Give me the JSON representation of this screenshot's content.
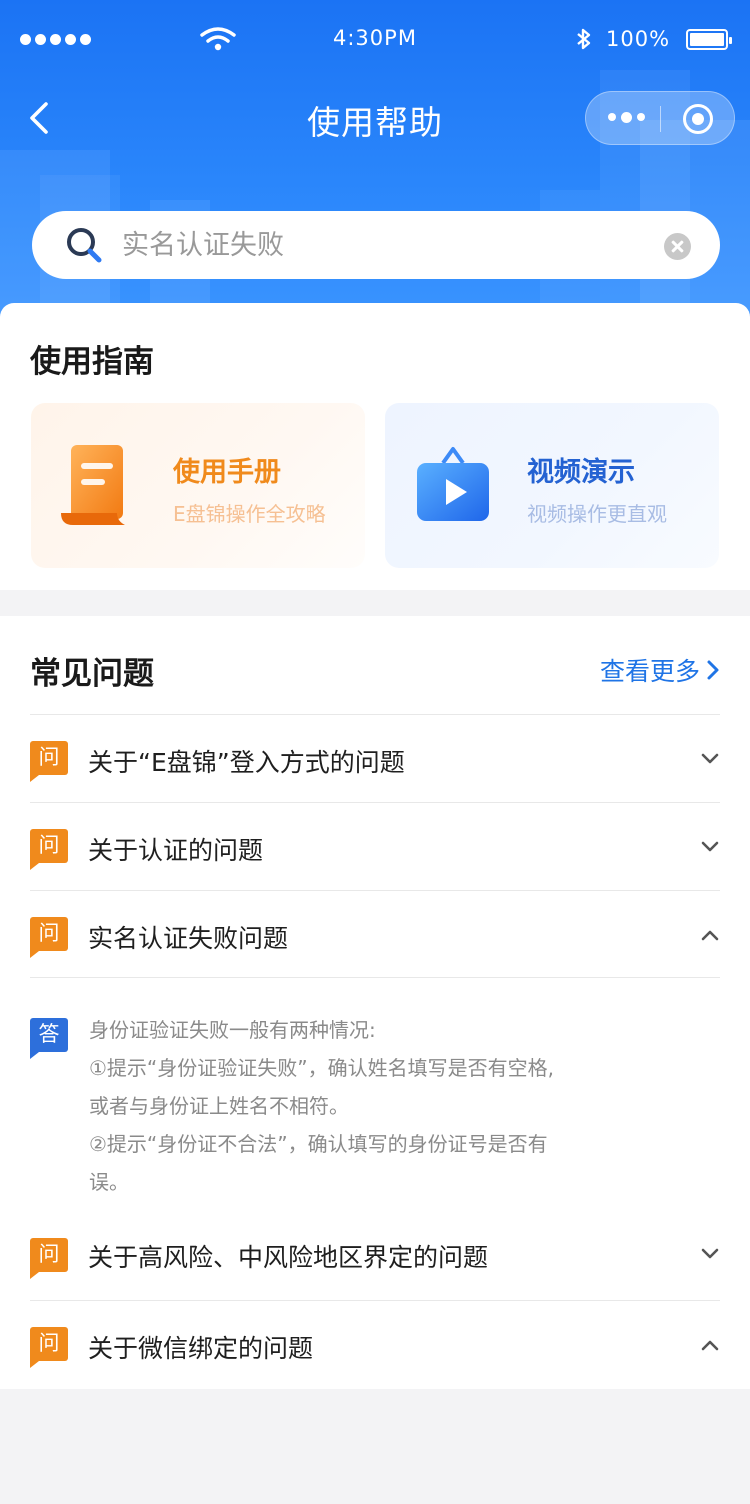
{
  "status_bar": {
    "time": "4:30PM",
    "battery": "100%"
  },
  "nav": {
    "title": "使用帮助"
  },
  "search": {
    "placeholder": "实名认证失败"
  },
  "guide": {
    "title": "使用指南",
    "tiles": [
      {
        "title": "使用手册",
        "subtitle": "E盘锦操作全攻略",
        "icon": "scroll-icon"
      },
      {
        "title": "视频演示",
        "subtitle": "视频操作更直观",
        "icon": "video-play-icon"
      }
    ]
  },
  "faq": {
    "title": "常见问题",
    "more_label": "查看更多",
    "q_badge": "问",
    "a_badge": "答",
    "items": [
      {
        "question": "关于“E盘锦”登入方式的问题",
        "expanded": false
      },
      {
        "question": "关于认证的问题",
        "expanded": false
      },
      {
        "question": "实名认证失败问题",
        "expanded": true
      },
      {
        "question": "关于高风险、中风险地区界定的问题",
        "expanded": false
      },
      {
        "question": "关于微信绑定的问题",
        "expanded": true
      }
    ],
    "answer_lines": [
      "身份证验证失败一般有两种情况:",
      "①提示“身份证验证失败”，确认姓名填写是否有空格,",
      "或者与身份证上姓名不相符。",
      "②提示“身份证不合法”，确认填写的身份证号是否有",
      "误。"
    ]
  },
  "colors": {
    "header_blue": "#1b73f4",
    "accent_orange": "#f08a1c",
    "answer_blue": "#2d6fdb",
    "link_blue": "#1f74e6"
  }
}
